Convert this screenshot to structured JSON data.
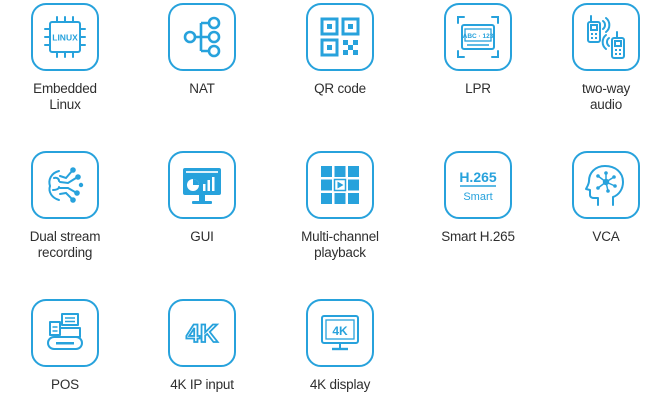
{
  "accent_color": "#27a2dc",
  "text_color": "#2e2e2e",
  "features": [
    {
      "label": "Embedded\nLinux",
      "icon": "chip-icon",
      "icon_text": "LINUX"
    },
    {
      "label": "NAT",
      "icon": "network-tree-icon"
    },
    {
      "label": "QR code",
      "icon": "qr-code-icon"
    },
    {
      "label": "LPR",
      "icon": "license-plate-icon",
      "icon_text": "ABC · 123"
    },
    {
      "label": "two-way\naudio",
      "icon": "walkie-talkie-icon"
    },
    {
      "label": "Dual stream\nrecording",
      "icon": "dual-stream-icon"
    },
    {
      "label": "GUI",
      "icon": "monitor-chart-icon"
    },
    {
      "label": "Multi-channel\nplayback",
      "icon": "grid-play-icon"
    },
    {
      "label": "Smart H.265",
      "icon": "h265-smart-icon",
      "icon_text": "H.265",
      "icon_subtext": "Smart"
    },
    {
      "label": "VCA",
      "icon": "head-brain-icon"
    },
    {
      "label": "POS",
      "icon": "pos-terminal-icon"
    },
    {
      "label": "4K IP input",
      "icon": "4k-outline-icon",
      "icon_text": "4K"
    },
    {
      "label": "4K display",
      "icon": "4k-monitor-icon",
      "icon_text": "4K"
    }
  ]
}
